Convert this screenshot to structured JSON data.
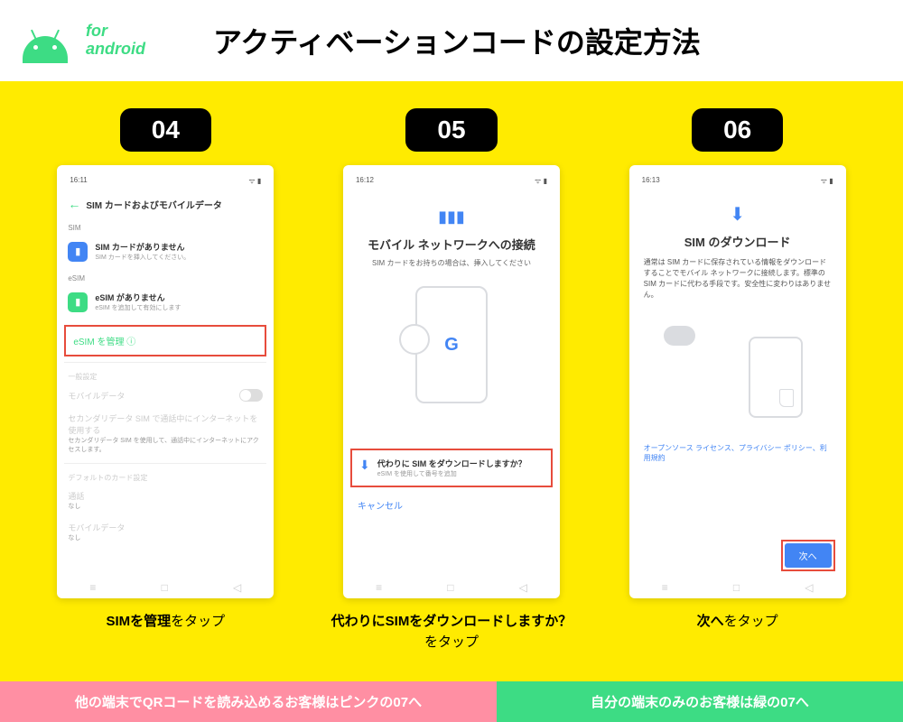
{
  "header": {
    "for": "for",
    "android": "android",
    "title": "アクティベーションコードの設定方法"
  },
  "steps": [
    {
      "num": "04",
      "phone": {
        "time": "16:11",
        "title": "SIM カードおよびモバイルデータ",
        "sim_label": "SIM",
        "sim_none": "SIM カードがありません",
        "sim_none_sub": "SIM カードを挿入してください。",
        "esim_label": "eSIM",
        "esim_none": "eSIM がありません",
        "esim_none_sub": "eSIM を追加して有効にします",
        "esim_manage": "eSIM を管理 ⓘ",
        "general": "一般設定",
        "mobile_data": "モバイルデータ",
        "secondary": "セカンダリデータ SIM で通話中にインターネットを使用する",
        "secondary_sub": "セカンダリデータ SIM を使用して、通話中にインターネットにアクセスします。",
        "default_card": "デフォルトのカード設定",
        "call": "通話",
        "none": "なし",
        "mobile": "モバイルデータ"
      },
      "caption_bold": "SIMを管理",
      "caption_rest": "をタップ"
    },
    {
      "num": "05",
      "phone": {
        "time": "16:12",
        "net_title": "モバイル ネットワークへの接続",
        "net_sub": "SIM カードをお持ちの場合は、挿入してください",
        "download_q": "代わりに SIM をダウンロードしますか？",
        "download_sub": "eSIM を使用して番号を追加",
        "cancel": "キャンセル"
      },
      "caption_bold": "代わりにSIMをダウンロードしますか？",
      "caption_rest": "をタップ"
    },
    {
      "num": "06",
      "phone": {
        "time": "16:13",
        "dl_title": "SIM のダウンロード",
        "dl_desc": "通常は SIM カードに保存されている情報をダウンロードすることでモバイル ネットワークに接続します。標準の SIM カードに代わる手段です。安全性に変わりはありません。",
        "links": "オープンソース ライセンス、プライバシー ポリシー、利用規約",
        "next": "次へ"
      },
      "caption_bold": "次へ",
      "caption_rest": "をタップ"
    }
  ],
  "footer": {
    "left": "他の端末でQRコードを読み込めるお客様はピンクの07へ",
    "right": "自分の端末のみのお客様は緑の07へ"
  }
}
